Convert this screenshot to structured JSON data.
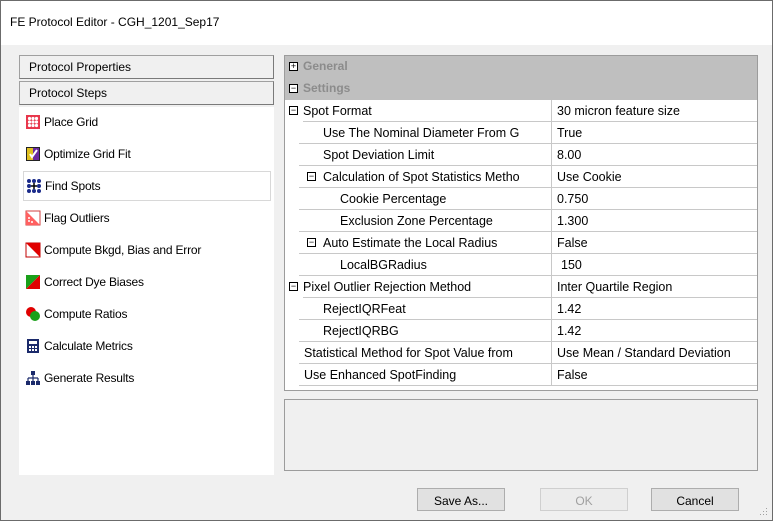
{
  "window": {
    "title": "FE Protocol Editor - CGH_1201_Sep17"
  },
  "left": {
    "protocol_properties": "Protocol Properties",
    "protocol_steps": "Protocol Steps",
    "steps": [
      {
        "label": "Place Grid",
        "icon": "place-grid-icon"
      },
      {
        "label": "Optimize Grid Fit",
        "icon": "optimize-grid-icon"
      },
      {
        "label": "Find Spots",
        "icon": "find-spots-icon",
        "selected": true
      },
      {
        "label": "Flag Outliers",
        "icon": "flag-outliers-icon"
      },
      {
        "label": "Compute Bkgd, Bias and Error",
        "icon": "compute-bkgd-icon"
      },
      {
        "label": "Correct Dye Biases",
        "icon": "correct-dye-icon"
      },
      {
        "label": "Compute Ratios",
        "icon": "compute-ratios-icon"
      },
      {
        "label": "Calculate Metrics",
        "icon": "calculate-metrics-icon"
      },
      {
        "label": "Generate Results",
        "icon": "generate-results-icon"
      }
    ]
  },
  "grid": {
    "cat_general": "General",
    "cat_settings": "Settings",
    "rows": [
      {
        "name": "Spot Format",
        "value": "30 micron feature size"
      },
      {
        "name": "Use The Nominal Diameter From G",
        "value": "True"
      },
      {
        "name": "Spot Deviation Limit",
        "value": "8.00"
      },
      {
        "name": "Calculation of Spot Statistics Metho",
        "value": "Use Cookie"
      },
      {
        "name": "Cookie Percentage",
        "value": "0.750"
      },
      {
        "name": "Exclusion Zone Percentage",
        "value": "1.300"
      },
      {
        "name": "Auto Estimate the Local Radius",
        "value": "False"
      },
      {
        "name": "LocalBGRadius",
        "value": "150"
      },
      {
        "name": "Pixel Outlier Rejection Method",
        "value": "Inter Quartile Region"
      },
      {
        "name": "RejectIQRFeat",
        "value": "1.42"
      },
      {
        "name": "RejectIQRBG",
        "value": "1.42"
      },
      {
        "name": "Statistical Method for Spot Value from",
        "value": "Use Mean / Standard Deviation"
      },
      {
        "name": "Use Enhanced SpotFinding",
        "value": "False"
      }
    ]
  },
  "buttons": {
    "save_as": "Save As...",
    "ok": "OK",
    "cancel": "Cancel"
  }
}
